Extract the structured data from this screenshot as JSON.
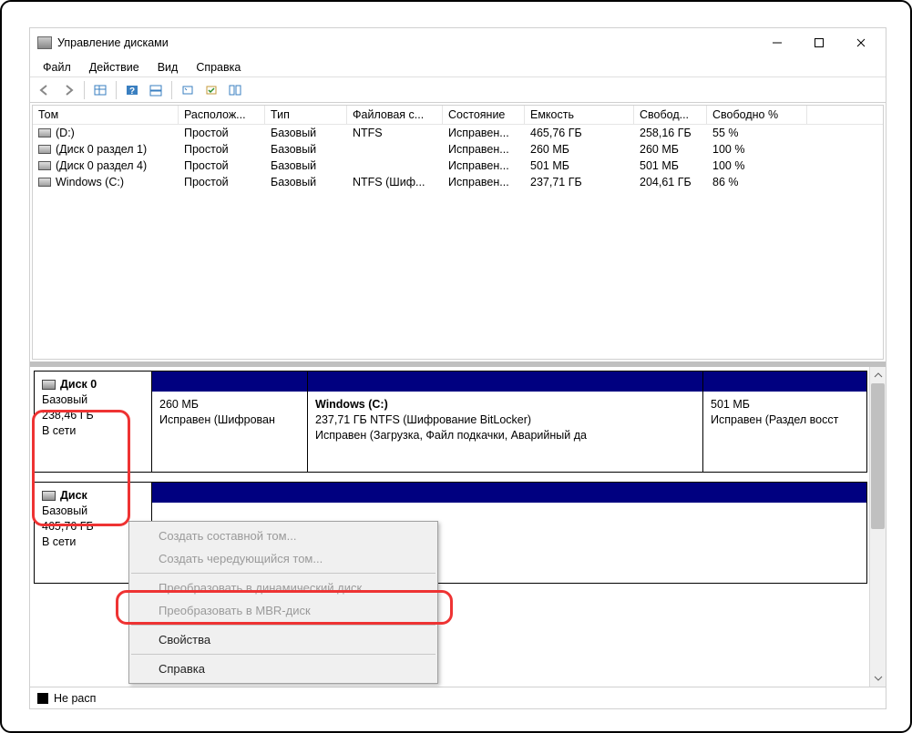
{
  "window": {
    "title": "Управление дисками"
  },
  "menu": {
    "file": "Файл",
    "action": "Действие",
    "view": "Вид",
    "help": "Справка"
  },
  "columns": {
    "volume": "Том",
    "layout": "Располож...",
    "type": "Тип",
    "filesystem": "Файловая с...",
    "status": "Состояние",
    "capacity": "Емкость",
    "free": "Свобод...",
    "freepct": "Свободно %"
  },
  "volumes": [
    {
      "name": "(D:)",
      "layout": "Простой",
      "type": "Базовый",
      "fs": "NTFS",
      "status": "Исправен...",
      "cap": "465,76 ГБ",
      "free": "258,16 ГБ",
      "pct": "55 %"
    },
    {
      "name": "(Диск 0 раздел 1)",
      "layout": "Простой",
      "type": "Базовый",
      "fs": "",
      "status": "Исправен...",
      "cap": "260 МБ",
      "free": "260 МБ",
      "pct": "100 %"
    },
    {
      "name": "(Диск 0 раздел 4)",
      "layout": "Простой",
      "type": "Базовый",
      "fs": "",
      "status": "Исправен...",
      "cap": "501 МБ",
      "free": "501 МБ",
      "pct": "100 %"
    },
    {
      "name": "Windows (C:)",
      "layout": "Простой",
      "type": "Базовый",
      "fs": "NTFS (Шиф...",
      "status": "Исправен...",
      "cap": "237,71 ГБ",
      "free": "204,61 ГБ",
      "pct": "86 %"
    }
  ],
  "disk0": {
    "title": "Диск 0",
    "type": "Базовый",
    "size": "238,46 ГБ",
    "status": "В сети",
    "p1": {
      "title": "",
      "line1": "260 МБ",
      "line2": "Исправен (Шифрован"
    },
    "p2": {
      "title": "Windows  (C:)",
      "line1": "237,71 ГБ NTFS (Шифрование BitLocker)",
      "line2": "Исправен (Загрузка, Файл подкачки, Аварийный да"
    },
    "p3": {
      "title": "",
      "line1": "501 МБ",
      "line2": "Исправен (Раздел восст"
    }
  },
  "disk1": {
    "title": "Диск",
    "type": "Базовый",
    "size": "465,76 ГБ",
    "status": "В сети"
  },
  "legend": {
    "unalloc": "Не расп"
  },
  "contextmenu": {
    "item1": "Создать составной том...",
    "item2": "Создать чередующийся том...",
    "item3": "Преобразовать в динамический диск...",
    "item4": "Преобразовать в MBR-диск",
    "item5": "Свойства",
    "item6": "Справка"
  }
}
